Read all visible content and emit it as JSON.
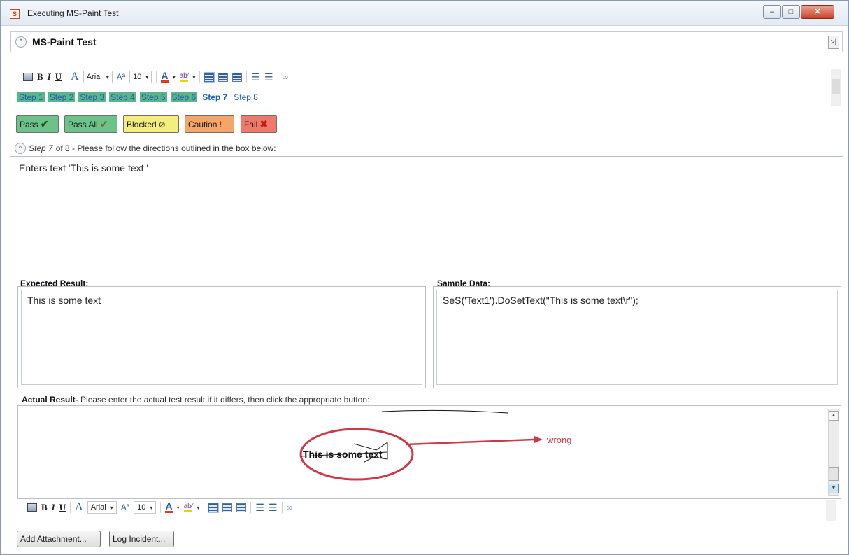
{
  "window": {
    "title": "Executing MS-Paint Test",
    "app_icon": "S",
    "controls": {
      "minimize": "–",
      "maximize": "□",
      "close": "✕"
    }
  },
  "header": {
    "title": "MS-Paint Test",
    "collapse_glyph": "^",
    "expand_glyph": ">|"
  },
  "toolbar": {
    "bold": "B",
    "italic": "I",
    "underline": "U",
    "font_glyph": "A",
    "font": "Arial",
    "size_glyph": "Aª",
    "size": "10",
    "color_glyph": "A",
    "highlight_glyph": "ab⁄",
    "arrow": "▾",
    "bullet_list": "☰",
    "numbered_list": "☰",
    "link": "∞"
  },
  "steps": [
    "Step 1",
    "Step 2",
    "Step 3",
    "Step 4",
    "Step 5",
    "Step 6",
    "Step 7",
    "Step 8"
  ],
  "result_buttons": {
    "pass": "Pass",
    "pass_all": "Pass All",
    "blocked": "Blocked",
    "caution": "Caution",
    "fail": "Fail",
    "icons": {
      "check": "✔",
      "checkall": "✔",
      "blocked": "⊘",
      "caution": "!",
      "fail": "✖"
    }
  },
  "step_info": {
    "step_label": "Step 7",
    "of_text": " of 8 - Please follow the directions outlined in the box below:",
    "description": "Enters text 'This is some text '"
  },
  "expected": {
    "label": "Expected Result:",
    "text": "This is some text"
  },
  "sample": {
    "label": "Sample Data:",
    "text": "SeS('Text1').DoSetText(\"This is some text\\r\");"
  },
  "actual": {
    "label": "Actual Result",
    "instruction": "- Please enter the actual test result if it differs, then click the appropriate button:",
    "annotation_text": "This is some text",
    "annotation_note": "wrong",
    "scroll_up": "▲",
    "scroll_down": "▼"
  },
  "footer": {
    "add_attachment": "Add Attachment...",
    "log_incident": "Log Incident..."
  },
  "colors": {
    "pass": "#6dc28a",
    "blocked": "#f4ee7e",
    "caution": "#f4a56a",
    "fail": "#ef7a6c",
    "step_pass_bg": "#5ab58a",
    "annotation": "#cc3a48"
  }
}
